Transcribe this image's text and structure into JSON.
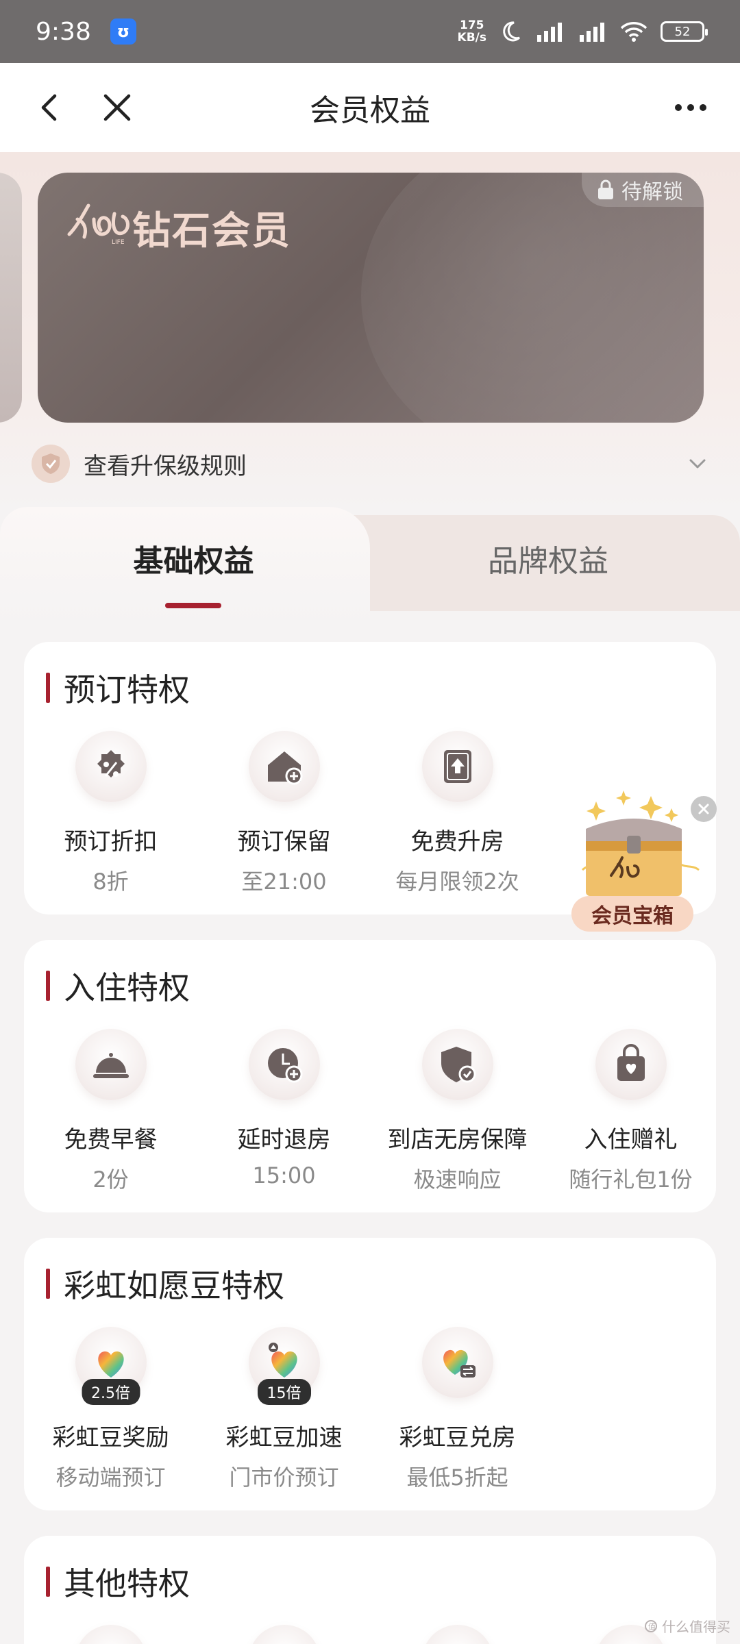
{
  "status_bar": {
    "time": "9:38",
    "app_badge": "ʊ",
    "net_speed_value": "175",
    "net_speed_unit": "KB/s",
    "battery": "52"
  },
  "nav": {
    "title": "会员权益",
    "icons": [
      "back-icon",
      "close-icon",
      "more-icon"
    ]
  },
  "card": {
    "title": "钻石会员",
    "lock_label": "待解锁"
  },
  "rules_link": "查看升保级规则",
  "tabs": [
    {
      "label": "基础权益",
      "active": true
    },
    {
      "label": "品牌权益",
      "active": false
    }
  ],
  "sections": {
    "booking": {
      "title": "预订特权",
      "items": [
        {
          "name": "预订折扣",
          "sub": "8折",
          "icon": "discount-icon"
        },
        {
          "name": "预订保留",
          "sub": "至21:00",
          "icon": "house-add-icon"
        },
        {
          "name": "免费升房",
          "sub": "每月限领2次",
          "icon": "upgrade-icon"
        }
      ]
    },
    "checkin": {
      "title": "入住特权",
      "items": [
        {
          "name": "免费早餐",
          "sub": "2份",
          "icon": "cloche-icon"
        },
        {
          "name": "延时退房",
          "sub": "15:00",
          "icon": "clock-add-icon"
        },
        {
          "name": "到店无房保障",
          "sub": "极速响应",
          "icon": "shield-check-icon"
        },
        {
          "name": "入住赠礼",
          "sub": "随行礼包1份",
          "icon": "gift-bag-icon"
        }
      ]
    },
    "rainbow": {
      "title": "彩虹如愿豆特权",
      "items": [
        {
          "name": "彩虹豆奖励",
          "sub": "移动端预订",
          "badge": "2.5倍",
          "icon": "rainbow-heart-icon"
        },
        {
          "name": "彩虹豆加速",
          "sub": "门市价预订",
          "badge": "15倍",
          "icon": "rainbow-heart-speed-icon"
        },
        {
          "name": "彩虹豆兑房",
          "sub": "最低5折起",
          "icon": "rainbow-heart-exchange-icon"
        }
      ]
    },
    "other": {
      "title": "其他特权"
    }
  },
  "treasure": {
    "label": "会员宝箱"
  },
  "watermark": "什么值得买",
  "colors": {
    "accent": "#a7212f",
    "card": "#7a6e6c",
    "card_text": "#f1d9cf"
  }
}
